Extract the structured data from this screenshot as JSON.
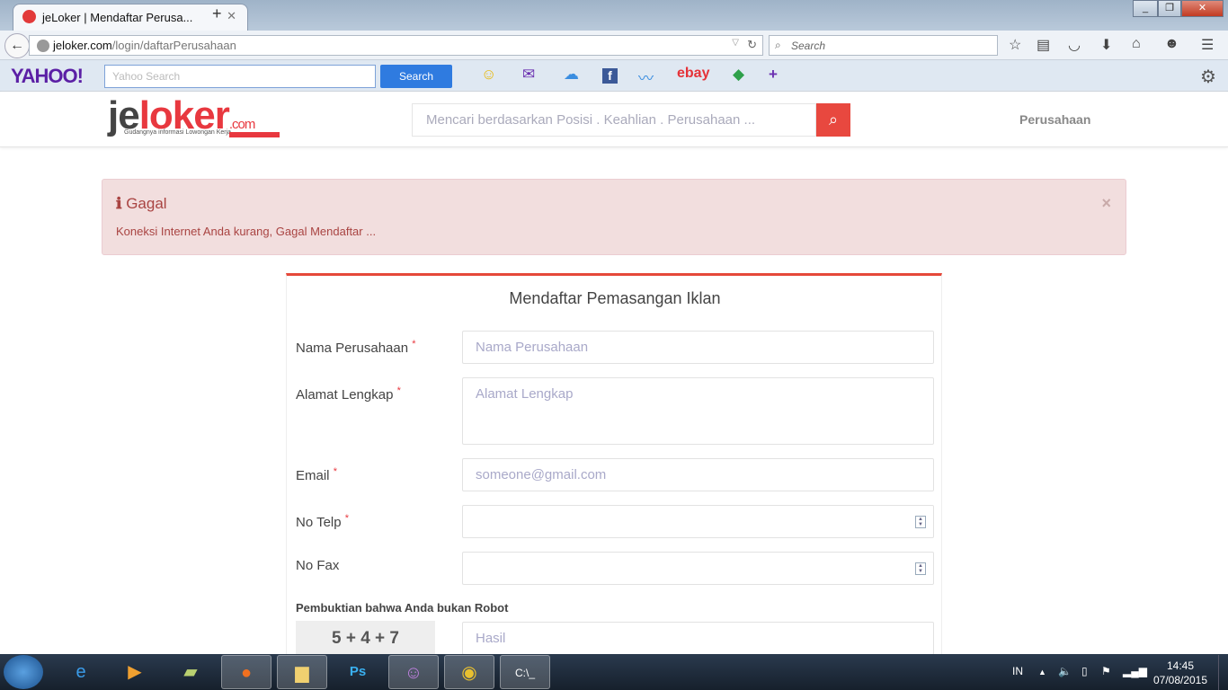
{
  "browser": {
    "tab_title": "jeLoker | Mendaftar Perusa...",
    "url_domain": "jeloker.com",
    "url_path": "/login/daftarPerusahaan",
    "search_placeholder": "Search"
  },
  "yahoo_bar": {
    "logo": "YAHOO!",
    "search_placeholder": "Yahoo Search",
    "search_button": "Search",
    "shortcuts": [
      "messenger",
      "mail",
      "weather",
      "facebook",
      "finance",
      "ebay",
      "shopping",
      "add"
    ],
    "ebay_label": "ebay"
  },
  "site": {
    "logo_main": "jeloker",
    "logo_je": "je",
    "logo_rest": "loker",
    "logo_com": ".com",
    "tagline": "Gudangnya informasi Lowongan Kerja",
    "search_placeholder": "Mencari berdasarkan Posisi . Keahlian . Perusahaan ...",
    "nav_perusahaan": "Perusahaan",
    "accent": "#e8383f"
  },
  "alert": {
    "icon": "info-icon",
    "title": "Gagal",
    "message": "Koneksi Internet Anda kurang, Gagal Mendaftar ...",
    "close": "×"
  },
  "form": {
    "title": "Mendaftar Pemasangan Iklan",
    "fields": [
      {
        "label": "Nama Perusahaan",
        "required": "*",
        "placeholder": "Nama Perusahaan"
      },
      {
        "label": "Alamat Lengkap",
        "required": "*",
        "placeholder": "Alamat Lengkap"
      },
      {
        "label": "Email",
        "required": "*",
        "placeholder": "someone@gmail.com"
      },
      {
        "label": "No Telp",
        "required": "*",
        "placeholder": ""
      },
      {
        "label": "No Fax",
        "placeholder": ""
      }
    ],
    "captcha_label": "Pembuktian bahwa Anda bukan Robot",
    "captcha": "5 + 4 + 7",
    "captcha_placeholder": "Hasil"
  },
  "taskbar": {
    "language": "IN",
    "time": "14:45",
    "date": "07/08/2015"
  }
}
